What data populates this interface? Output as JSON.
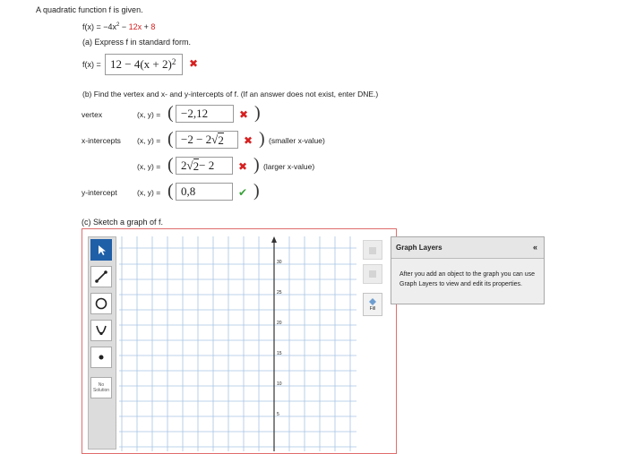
{
  "intro": "A quadratic function f is given.",
  "function": {
    "lhs": "f(x) = ",
    "part1": "−4x",
    "part1_sup": "2",
    "part2": " − ",
    "part3": "12x",
    "part4": " + ",
    "part5": "8"
  },
  "part_a": {
    "prompt": "(a) Express f in standard form.",
    "lhs": "f(x) =",
    "answer": "12 − 4(x + 2)",
    "answer_sup": "2",
    "status": "incorrect"
  },
  "part_b": {
    "prompt": "(b) Find the vertex and x- and y-intercepts of f. (If an answer does not exist, enter DNE.)",
    "coord_label": "(x, y) =",
    "rows": [
      {
        "label": "vertex",
        "value": "−2,12",
        "status": "incorrect",
        "note": ""
      },
      {
        "label": "x-intercepts",
        "value_prefix": "−2 − 2",
        "value_radicand": "2",
        "value_suffix": "",
        "status": "incorrect",
        "note": "(smaller x-value)"
      },
      {
        "label": "",
        "value_prefix": "2",
        "value_radicand": "2",
        "value_suffix": " − 2",
        "status": "incorrect",
        "note": "(larger x-value)"
      },
      {
        "label": "y-intercept",
        "value": "0,8",
        "status": "correct",
        "note": ""
      }
    ]
  },
  "part_c": {
    "prompt": "(c) Sketch a graph of f.",
    "tools": [
      "pointer",
      "line",
      "circle",
      "parabola",
      "point",
      "no-solution"
    ],
    "no_solution_label": [
      "No",
      "Solution"
    ],
    "fill_label": "Fill",
    "y_ticks": [
      "30",
      "25",
      "20",
      "15",
      "10",
      "5"
    ],
    "layers_panel": {
      "title": "Graph Layers",
      "collapse": "«",
      "text": "After you add an object to the graph you can use Graph Layers to view and edit its properties."
    }
  },
  "colors": {
    "incorrect": "#d62020",
    "correct": "#3aa23a",
    "frame_border": "#e06c6c",
    "tool_selected": "#1f5fa8"
  }
}
